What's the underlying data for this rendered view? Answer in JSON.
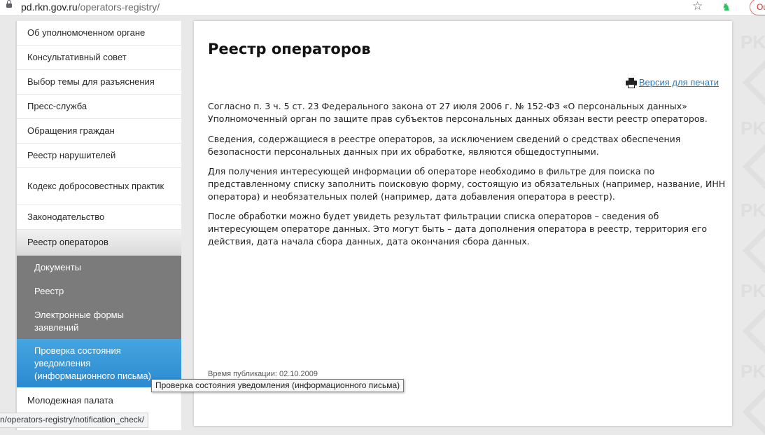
{
  "browser": {
    "url_host": "pd.rkn.gov.ru",
    "url_path": "/operators-registry/",
    "profile_label": "Ou",
    "status_url": "n/operators-registry/notification_check/"
  },
  "watermark": {
    "text": "PKI"
  },
  "sidebar": {
    "items": [
      {
        "label": "Об уполномоченном органе"
      },
      {
        "label": "Консультативный совет"
      },
      {
        "label": "Выбор темы для разъяснения"
      },
      {
        "label": "Пресс-служба"
      },
      {
        "label": "Обращения граждан"
      },
      {
        "label": "Реестр нарушителей"
      },
      {
        "label": "Кодекс добросовестных практик"
      },
      {
        "label": "Законодательство"
      },
      {
        "label": "Реестр операторов"
      }
    ],
    "subitems": [
      {
        "label": "Документы"
      },
      {
        "label": "Реестр"
      },
      {
        "label": "Электронные формы заявлений"
      },
      {
        "label": "Проверка состояния уведомления (информационного письма)"
      }
    ],
    "after_items": [
      {
        "label": "Молодежная палата"
      }
    ]
  },
  "main": {
    "title": "Реестр операторов",
    "print_label": "Версия для печати",
    "paragraphs": [
      "Согласно п. 3 ч. 5 ст. 23 Федерального закона от 27 июля 2006 г. № 152-ФЗ «О персональных данных» Уполномоченный орган по защите прав субъектов персональных данных обязан вести реестр операторов.",
      "Сведения, содержащиеся в реестре операторов, за исключением сведений о средствах обеспечения безопасности персональных данных при их обработке, являются общедоступными.",
      "Для получения интересующей информации об операторе необходимо в фильтре для поиска по представленному списку заполнить поисковую форму, состоящую из обязательных (например,  название, ИНН оператора) и необязательных полей (например, дата добавления оператора в реестр).",
      "После обработки можно будет увидеть результат фильтрации списка операторов – сведения об интересующем операторе данных. Это могут быть – дата дополнения оператора в реестр, территория его действия, дата начала сбора данных, дата окончания сбора данных."
    ],
    "publication_time": "Время публикации: 02.10.2009"
  },
  "tooltip": {
    "text": "Проверка состояния уведомления (информационного письма)"
  }
}
